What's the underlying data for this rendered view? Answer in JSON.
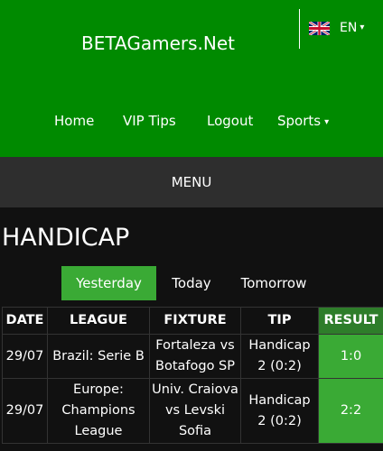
{
  "header": {
    "brand": "BETAGamers.Net",
    "language": {
      "code": "EN",
      "flag": "uk-flag-icon",
      "caret": "▾"
    }
  },
  "nav": {
    "items": [
      "Home",
      "VIP Tips",
      "Logout",
      "Sports"
    ],
    "sports_caret": "▾"
  },
  "menu": {
    "label": "MENU"
  },
  "page": {
    "title": "HANDICAP"
  },
  "day_tabs": [
    {
      "label": "Yesterday",
      "active": true
    },
    {
      "label": "Today",
      "active": false
    },
    {
      "label": "Tomorrow",
      "active": false
    }
  ],
  "table": {
    "headers": [
      "DATE",
      "LEAGUE",
      "FIXTURE",
      "TIP",
      "RESULT"
    ],
    "rows": [
      {
        "date": "29/07",
        "league": "Brazil: Serie B",
        "fixture": "Fortaleza vs Botafogo SP",
        "tip": "Handicap 2 (0:2)",
        "result": "1:0"
      },
      {
        "date": "29/07",
        "league": "Europe: Champions League",
        "fixture": "Univ. Craiova vs Levski Sofia",
        "tip": "Handicap 2 (0:2)",
        "result": "2:2"
      }
    ]
  },
  "colors": {
    "header_green": "#008a00",
    "menu_bar": "#2e2e2e",
    "accent_green": "#3aaa35",
    "background": "#111111"
  }
}
